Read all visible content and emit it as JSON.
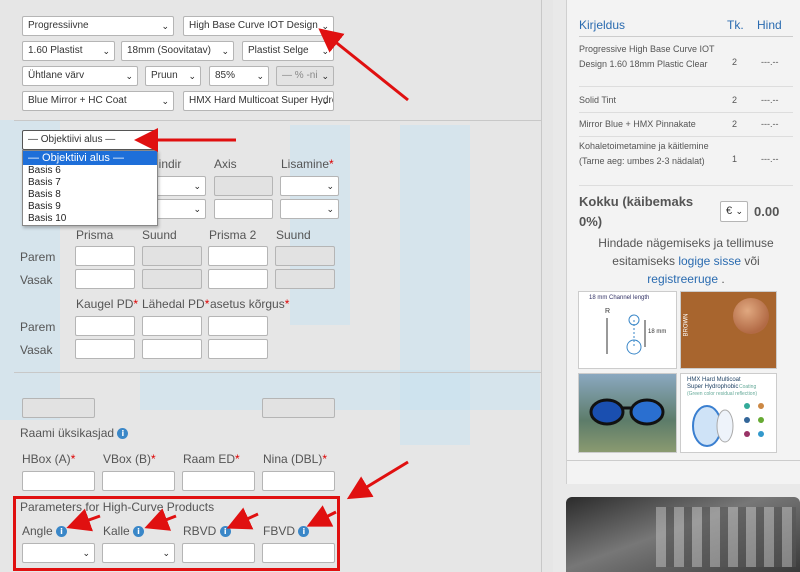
{
  "lens": {
    "design": "Progressiivne",
    "product": "High Base Curve IOT Design",
    "index": "1.60 Plastist",
    "height": "18mm (Soovitatav)",
    "material": "Plastist Selge",
    "tint_type": "Ühtlane värv",
    "tint_color": "Pruun",
    "tint_percent": "85%",
    "gradient": "— % -ni",
    "mirror": "Blue Mirror + HC Coat",
    "coating": "HMX Hard Multicoat Super Hydrophobic"
  },
  "base": {
    "value": "— Objektiivi alus —",
    "options": [
      "— Objektiivi alus —",
      "Basis 6",
      "Basis 7",
      "Basis 8",
      "Basis 9",
      "Basis 10"
    ]
  },
  "prescription": {
    "col_cylinder": "lindir",
    "col_axis": "Axis",
    "col_add": "Lisamine",
    "prism_headers": [
      "Prisma",
      "Suund",
      "Prisma 2",
      "Suund"
    ],
    "row_right": "Parem",
    "row_left": "Vasak",
    "pd_far": "Kaugel PD",
    "pd_near": "Lähedal PD",
    "fit_height": "asetus kõrgus"
  },
  "frame": {
    "title": "Raami üksikasjad",
    "hbox": "HBox (A)",
    "vbox": "VBox (B)",
    "raam_ed": "Raam ED",
    "nina": "Nina (DBL)"
  },
  "high_curve": {
    "title": "Parameters for High-Curve Products",
    "angle": "Angle",
    "kalle": "Kalle",
    "rbvd": "RBVD",
    "fbvd": "FBVD"
  },
  "summary": {
    "col_desc": "Kirjeldus",
    "col_qty": "Tk.",
    "col_price": "Hind",
    "rows": [
      {
        "desc": "Progressive High Base Curve IOT Design 1.60 18mm Plastic Clear",
        "qty": "2",
        "price": "---.--"
      },
      {
        "desc": "Solid Tint",
        "qty": "2",
        "price": "---.--"
      },
      {
        "desc": "Mirror Blue + HMX Pinnakate",
        "qty": "2",
        "price": "---.--"
      },
      {
        "desc": "Kohaletoimetamine ja käitlemine (Tarne aeg: umbes 2-3 nädalat)",
        "qty": "1",
        "price": "---.--"
      }
    ],
    "total_label": "Kokku (käibemaks 0%)",
    "currency": "€",
    "total": "0.00",
    "login_text_1": "Hindade nägemiseks ja tellimuse esitamiseks",
    "login_link": "logige sisse",
    "or_text": "või",
    "register_link": "registreeruge",
    "dot": "."
  },
  "thumbs": {
    "channel_caption": "18 mm Channel length",
    "channel_r": "R",
    "channel_mm": "18 mm",
    "brown_caption": "BROWN",
    "hmx_caption_1": "HMX Hard Multicoat",
    "hmx_caption_2": "Super Hydrophobic",
    "hmx_caption_3": "Coating",
    "hmx_caption_4": "(Green color residual reflection)"
  },
  "colors": {
    "accent_blue": "#1e6fd9",
    "link": "#2a6bb0",
    "arrow_red": "#e01010",
    "required_red": "#d00000",
    "brown_swatch": "#a8652e"
  }
}
